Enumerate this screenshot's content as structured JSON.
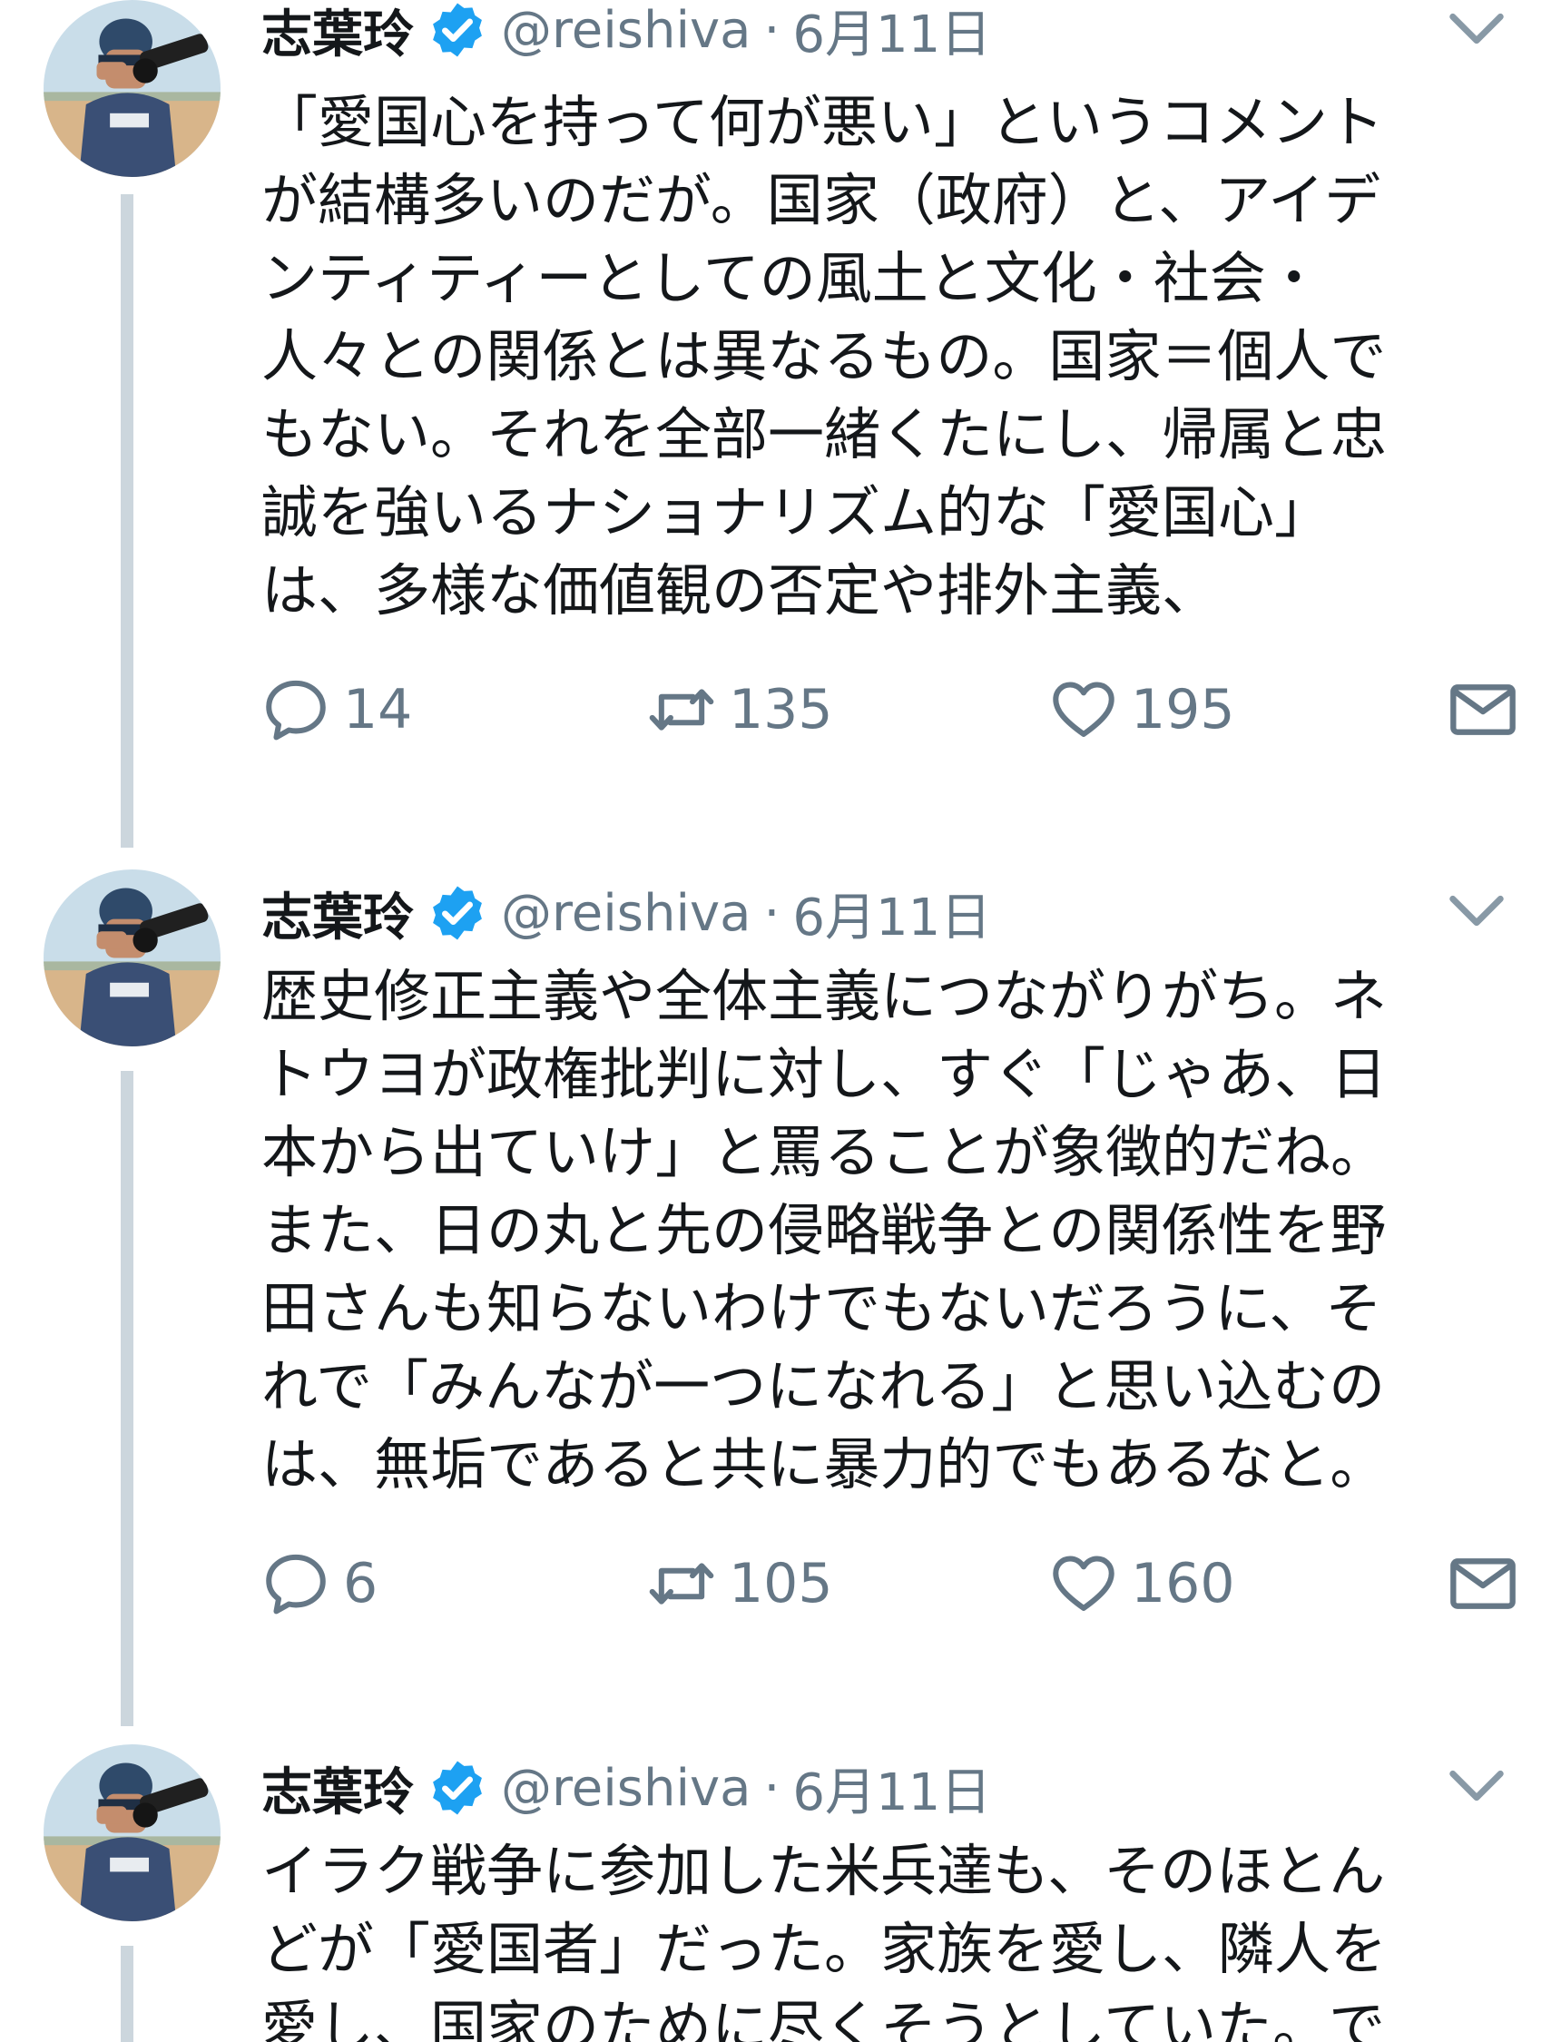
{
  "tweets": [
    {
      "name": "志葉玲",
      "handle": "@reishiva",
      "separator": "·",
      "date": "6月11日",
      "lines": [
        "「愛国心を持って何が悪い」というコメント",
        "が結構多いのだが。国家（政府）と、アイデ",
        "ンティティーとしての風土と文化・社会・",
        "人々との関係とは異なるもの。国家＝個人で",
        "もない。それを全部一緒くたにし、帰属と忠",
        "誠を強いるナショナリズム的な「愛国心」",
        "は、多様な価値観の否定や排外主義、"
      ],
      "replies": "14",
      "retweets": "135",
      "likes": "195"
    },
    {
      "name": "志葉玲",
      "handle": "@reishiva",
      "separator": "·",
      "date": "6月11日",
      "lines": [
        "歴史修正主義や全体主義につながりがち。ネ",
        "トウヨが政権批判に対し、すぐ「じゃあ、日",
        "本から出ていけ」と罵ることが象徴的だね。",
        "また、日の丸と先の侵略戦争との関係性を野",
        "田さんも知らないわけでもないだろうに、そ",
        "れで「みんなが一つになれる」と思い込むの",
        "は、無垢であると共に暴力的でもあるなと。"
      ],
      "replies": "6",
      "retweets": "105",
      "likes": "160"
    },
    {
      "name": "志葉玲",
      "handle": "@reishiva",
      "separator": "·",
      "date": "6月11日",
      "lines": [
        "イラク戦争に参加した米兵達も、そのほとん",
        "どが「愛国者」だった。家族を愛し、隣人を",
        "愛し、国家のために尽くそうとしていた。で"
      ]
    }
  ],
  "icons": {
    "avatar": "avatar-photographer",
    "verified": "verified-badge-icon",
    "caret": "chevron-down-icon",
    "reply": "reply-icon",
    "retweet": "retweet-icon",
    "like": "heart-icon",
    "dm": "envelope-icon"
  },
  "colors": {
    "text": "#14171a",
    "muted": "#657786",
    "verified": "#1da1f2",
    "thread_line": "#ccd6dd",
    "caret": "#8899a6"
  }
}
